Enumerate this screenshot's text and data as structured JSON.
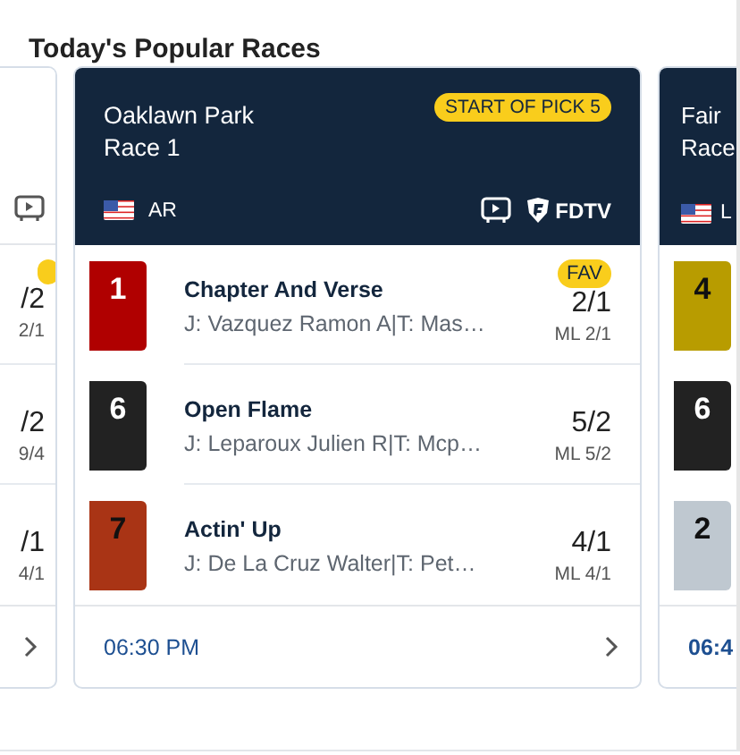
{
  "section": {
    "title": "Today's Popular Races"
  },
  "cards": [
    {
      "kind": "partial-left",
      "dark": false,
      "has_video": true,
      "runners": [
        {
          "odds": "/2",
          "morning_line": "2/1",
          "favorite": true
        },
        {
          "odds": "/2",
          "morning_line": "9/4",
          "favorite": false
        },
        {
          "odds": "/1",
          "morning_line": "4/1",
          "favorite": false
        }
      ]
    },
    {
      "kind": "full",
      "dark": true,
      "track": "Oaklawn Park",
      "race": "Race 1",
      "country": "AR",
      "badge": "START OF PICK 5",
      "has_video": true,
      "fdtv_label": "FDTV",
      "post_time": "06:30 PM",
      "runners": [
        {
          "number": "1",
          "color": "#b00000",
          "name": "Chapter And Verse",
          "jockey_trainer": "J: Vazquez Ramon A|T: Mas…",
          "odds": "2/1",
          "morning_line": "ML 2/1",
          "favorite": true,
          "favorite_label": "FAV"
        },
        {
          "number": "6",
          "color": "#222222",
          "name": "Open Flame",
          "jockey_trainer": "J: Leparoux Julien R|T: Mcp…",
          "odds": "5/2",
          "morning_line": "ML 5/2",
          "favorite": false
        },
        {
          "number": "7",
          "color": "#a93415",
          "name": "Actin' Up",
          "jockey_trainer": "J: De La Cruz Walter|T: Pet…",
          "odds": "4/1",
          "morning_line": "ML 4/1",
          "favorite": false
        }
      ]
    },
    {
      "kind": "partial-right",
      "dark": true,
      "track": "Fair",
      "race": "Race",
      "country": "L",
      "post_time": "06:4",
      "runners": [
        {
          "number": "4",
          "color": "#b89c00"
        },
        {
          "number": "6",
          "color": "#222222"
        },
        {
          "number": "2",
          "color": "#bfc8d0"
        }
      ]
    }
  ]
}
